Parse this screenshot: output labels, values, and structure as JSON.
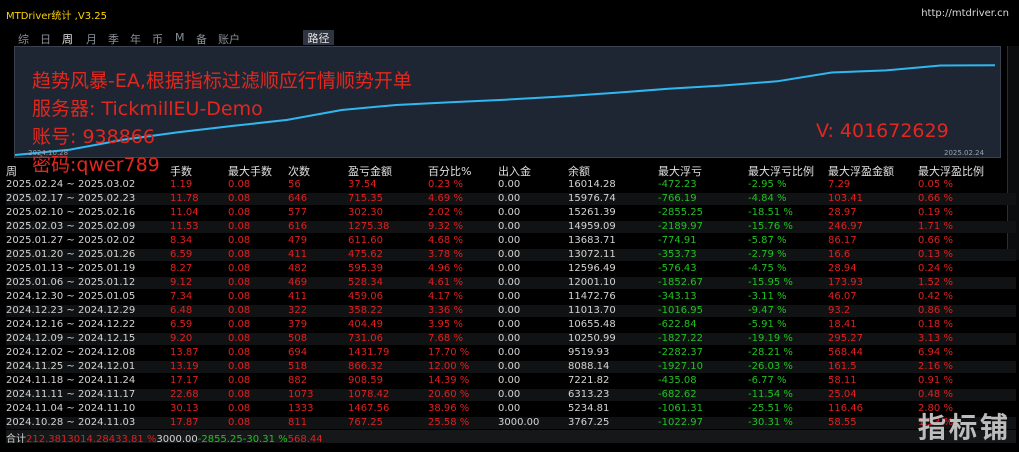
{
  "window": {
    "title": "MTDriver统计 ,V3.25",
    "url": "http://mtdriver.cn"
  },
  "tabs": [
    "综",
    "日",
    "周",
    "月",
    "季",
    "年",
    "币",
    "M",
    "备",
    "账户"
  ],
  "active_tab": "周",
  "route_label": "路径",
  "overlay": {
    "line1": "趋势风暴-EA,根据指标过滤顺应行情顺势开单",
    "line2": "服务器: TickmillEU-Demo",
    "line3": "账号: 938866",
    "line4": "密码:qwer789",
    "v_label": "V: 401672629"
  },
  "chart": {
    "start_label": "2024.10.28",
    "end_label": "2025.02.24",
    "line_color": "#2fb8f0"
  },
  "columns": [
    "周",
    "手数",
    "最大手数",
    "次数",
    "盈亏金额",
    "百分比%",
    "出入金",
    "余额",
    "最大浮亏",
    "最大浮亏比例",
    "最大浮盈金额",
    "最大浮盈比例"
  ],
  "rows": [
    [
      "2025.02.24 ~ 2025.03.02",
      "1.19",
      "0.08",
      "56",
      "37.54",
      "0.23 %",
      "0.00",
      "16014.28",
      "-472.23",
      "-2.95 %",
      "7.29",
      "0.05 %"
    ],
    [
      "2025.02.17 ~ 2025.02.23",
      "11.78",
      "0.08",
      "646",
      "715.35",
      "4.69 %",
      "0.00",
      "15976.74",
      "-766.19",
      "-4.84 %",
      "103.41",
      "0.66 %"
    ],
    [
      "2025.02.10 ~ 2025.02.16",
      "11.04",
      "0.08",
      "577",
      "302.30",
      "2.02 %",
      "0.00",
      "15261.39",
      "-2855.25",
      "-18.51 %",
      "28.97",
      "0.19 %"
    ],
    [
      "2025.02.03 ~ 2025.02.09",
      "11.53",
      "0.08",
      "616",
      "1275.38",
      "9.32 %",
      "0.00",
      "14959.09",
      "-2189.97",
      "-15.76 %",
      "246.97",
      "1.71 %"
    ],
    [
      "2025.01.27 ~ 2025.02.02",
      "8.34",
      "0.08",
      "479",
      "611.60",
      "4.68 %",
      "0.00",
      "13683.71",
      "-774.91",
      "-5.87 %",
      "86.17",
      "0.66 %"
    ],
    [
      "2025.01.20 ~ 2025.01.26",
      "6.59",
      "0.08",
      "411",
      "475.62",
      "3.78 %",
      "0.00",
      "13072.11",
      "-353.73",
      "-2.79 %",
      "16.6",
      "0.13 %"
    ],
    [
      "2025.01.13 ~ 2025.01.19",
      "8.27",
      "0.08",
      "482",
      "595.39",
      "4.96 %",
      "0.00",
      "12596.49",
      "-576.43",
      "-4.75 %",
      "28.94",
      "0.24 %"
    ],
    [
      "2025.01.06 ~ 2025.01.12",
      "9.12",
      "0.08",
      "469",
      "528.34",
      "4.61 %",
      "0.00",
      "12001.10",
      "-1852.67",
      "-15.95 %",
      "173.93",
      "1.52 %"
    ],
    [
      "2024.12.30 ~ 2025.01.05",
      "7.34",
      "0.08",
      "411",
      "459.06",
      "4.17 %",
      "0.00",
      "11472.76",
      "-343.13",
      "-3.11 %",
      "46.07",
      "0.42 %"
    ],
    [
      "2024.12.23 ~ 2024.12.29",
      "6.48",
      "0.08",
      "322",
      "358.22",
      "3.36 %",
      "0.00",
      "11013.70",
      "-1016.95",
      "-9.47 %",
      "93.2",
      "0.86 %"
    ],
    [
      "2024.12.16 ~ 2024.12.22",
      "6.59",
      "0.08",
      "379",
      "404.49",
      "3.95 %",
      "0.00",
      "10655.48",
      "-622.84",
      "-5.91 %",
      "18.41",
      "0.18 %"
    ],
    [
      "2024.12.09 ~ 2024.12.15",
      "9.20",
      "0.08",
      "508",
      "731.06",
      "7.68 %",
      "0.00",
      "10250.99",
      "-1827.22",
      "-19.19 %",
      "295.27",
      "3.13 %"
    ],
    [
      "2024.12.02 ~ 2024.12.08",
      "13.87",
      "0.08",
      "694",
      "1431.79",
      "17.70 %",
      "0.00",
      "9519.93",
      "-2282.37",
      "-28.21 %",
      "568.44",
      "6.94 %"
    ],
    [
      "2024.11.25 ~ 2024.12.01",
      "13.19",
      "0.08",
      "518",
      "866.32",
      "12.00 %",
      "0.00",
      "8088.14",
      "-1927.10",
      "-26.03 %",
      "161.5",
      "2.16 %"
    ],
    [
      "2024.11.18 ~ 2024.11.24",
      "17.17",
      "0.08",
      "882",
      "908.59",
      "14.39 %",
      "0.00",
      "7221.82",
      "-435.08",
      "-6.77 %",
      "58.11",
      "0.91 %"
    ],
    [
      "2024.11.11 ~ 2024.11.17",
      "22.68",
      "0.08",
      "1073",
      "1078.42",
      "20.60 %",
      "0.00",
      "6313.23",
      "-682.62",
      "-11.54 %",
      "25.04",
      "0.48 %"
    ],
    [
      "2024.11.04 ~ 2024.11.10",
      "30.13",
      "0.08",
      "1333",
      "1467.56",
      "38.96 %",
      "0.00",
      "5234.81",
      "-1061.31",
      "-25.51 %",
      "116.46",
      "2.80 %"
    ],
    [
      "2024.10.28 ~ 2024.11.03",
      "17.87",
      "0.08",
      "811",
      "767.25",
      "25.58 %",
      "3000.00",
      "3767.25",
      "-1022.97",
      "-30.31 %",
      "58.55",
      "1.53 %"
    ]
  ],
  "total": [
    "合计",
    "212.38",
    "",
    "",
    "13014.28",
    "433.81 %",
    "3000.00",
    "",
    "-2855.25",
    "-30.31 %",
    "568.44",
    ""
  ],
  "watermark": "指标铺"
}
